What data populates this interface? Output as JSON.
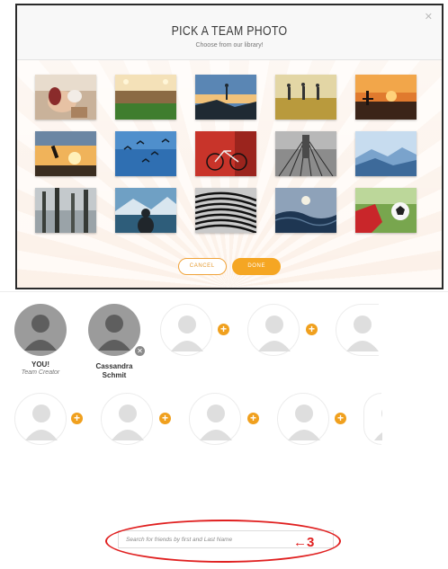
{
  "modal": {
    "title": "PICK A TEAM PHOTO",
    "subtitle": "Choose from our library!",
    "close_icon": "close-icon",
    "photos": [
      "hands-stacked-teamwork",
      "stadium-field",
      "hiker-silhouette-sunset",
      "runners-in-field",
      "surfer-at-sunset",
      "person-jumping-sunset",
      "birds-in-sky",
      "red-bicycle-red-wall",
      "bridge-cables",
      "blue-mountain-ridges",
      "misty-forest",
      "person-facing-mountain-lake",
      "abstract-spiral-lines",
      "ocean-wave-dusk",
      "soccer-ball-kick"
    ],
    "cancel_label": "CANCEL",
    "done_label": "DONE"
  },
  "members": {
    "you_name": "YOU!",
    "you_role": "Team Creator",
    "friend_name_line1": "Cassandra",
    "friend_name_line2": "Schmit",
    "remove_icon": "remove-icon",
    "add_icon": "plus-icon"
  },
  "search": {
    "placeholder": "Search for friends by first and Last Name"
  },
  "annotation": {
    "label": "3",
    "arrow_icon": "left-arrow-icon",
    "color": "#e02020"
  },
  "colors": {
    "accent": "#f5a623",
    "avatar_filled": "#9b9b9b",
    "avatar_empty": "#dedede"
  }
}
